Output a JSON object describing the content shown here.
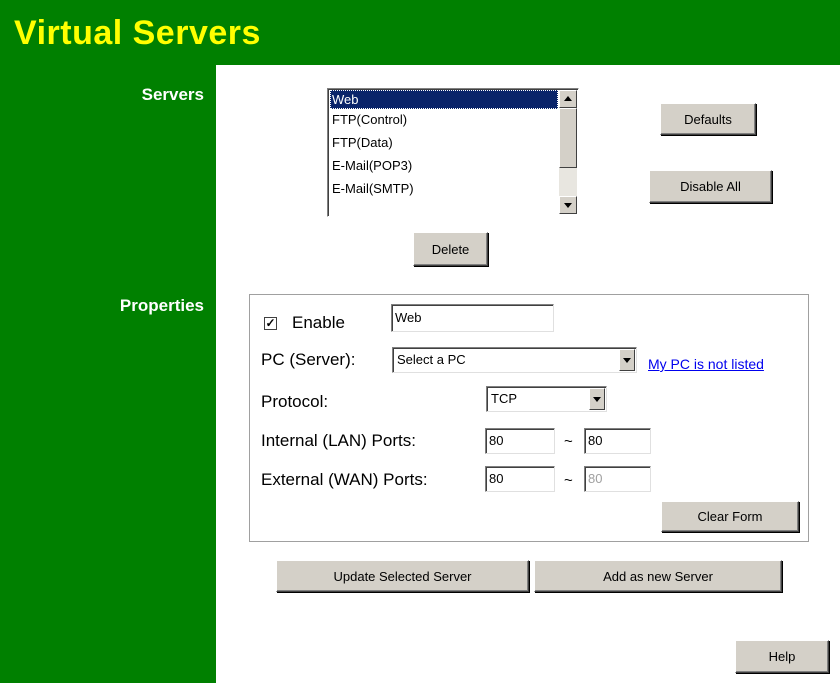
{
  "page": {
    "title": "Virtual Servers"
  },
  "colors": {
    "header_bg": "#008000",
    "title_color": "#ffff00",
    "selection_bg": "#0a246a",
    "link_color": "#0000ee"
  },
  "servers": {
    "section_label": "Servers",
    "items": [
      "Web",
      "FTP(Control)",
      "FTP(Data)",
      "E-Mail(POP3)",
      "E-Mail(SMTP)"
    ],
    "selected": "Web",
    "defaults_label": "Defaults",
    "disable_all_label": "Disable All",
    "delete_label": "Delete"
  },
  "properties": {
    "section_label": "Properties",
    "enable": {
      "label": "Enable",
      "checked": true,
      "check_glyph": "✓"
    },
    "name_value": "Web",
    "pc": {
      "label": "PC (Server):",
      "selected": "Select a PC",
      "link": "My PC is not listed"
    },
    "protocol": {
      "label": "Protocol:",
      "selected": "TCP"
    },
    "internal": {
      "label": "Internal (LAN) Ports:",
      "from": "80",
      "tilde": "~",
      "to": "80"
    },
    "external": {
      "label": "External (WAN) Ports:",
      "from": "80",
      "tilde": "~",
      "to": "80"
    },
    "clear_form_label": "Clear Form"
  },
  "actions": {
    "update_label": "Update Selected Server",
    "add_label": "Add as new Server",
    "help_label": "Help"
  }
}
